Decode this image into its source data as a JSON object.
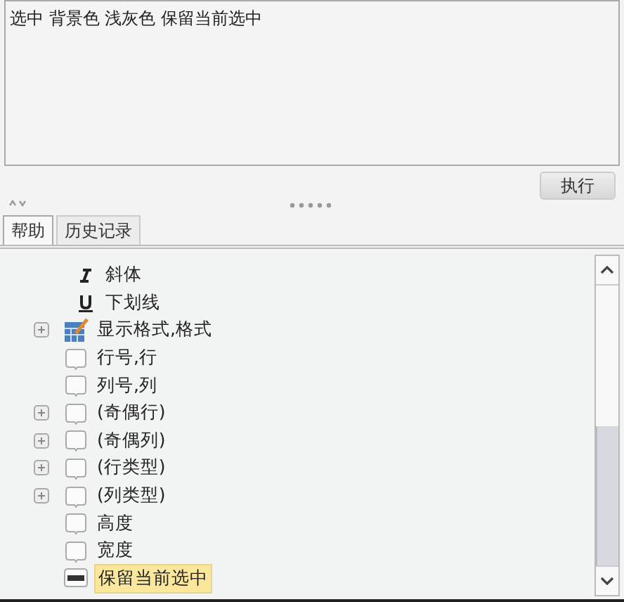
{
  "editor": {
    "value": "选中 背景色 浅灰色 保留当前选中"
  },
  "run_button": "执行",
  "tabs": [
    {
      "label": "帮助",
      "selected": true
    },
    {
      "label": "历史记录",
      "selected": false
    }
  ],
  "tree": [
    {
      "kind": "italic",
      "label": "斜体",
      "expandable": false,
      "selected": false
    },
    {
      "kind": "underline",
      "label": "下划线",
      "expandable": false,
      "selected": false
    },
    {
      "kind": "format",
      "label": "显示格式,格式",
      "expandable": true,
      "expanded": false,
      "selected": false
    },
    {
      "kind": "bubble",
      "label": "行号,行",
      "expandable": false,
      "selected": false
    },
    {
      "kind": "bubble",
      "label": "列号,列",
      "expandable": false,
      "selected": false
    },
    {
      "kind": "bubble",
      "label": "(奇偶行)",
      "expandable": true,
      "expanded": false,
      "selected": false
    },
    {
      "kind": "bubble",
      "label": "(奇偶列)",
      "expandable": true,
      "expanded": false,
      "selected": false
    },
    {
      "kind": "bubble",
      "label": "(行类型)",
      "expandable": true,
      "expanded": false,
      "selected": false
    },
    {
      "kind": "bubble",
      "label": "(列类型)",
      "expandable": true,
      "expanded": false,
      "selected": false
    },
    {
      "kind": "bubble",
      "label": "高度",
      "expandable": false,
      "selected": false
    },
    {
      "kind": "bubble",
      "label": "宽度",
      "expandable": false,
      "selected": false
    },
    {
      "kind": "bool",
      "label": "保留当前选中",
      "expandable": false,
      "selected": true
    }
  ]
}
